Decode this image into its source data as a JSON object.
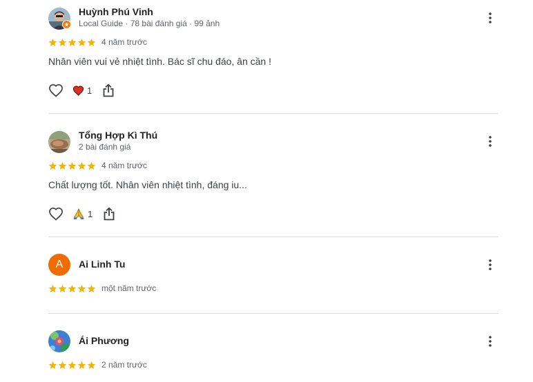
{
  "reviews": [
    {
      "name": "Huỳnh Phú Vinh",
      "meta": "Local Guide · 78 bài đánh giá · 99 ảnh",
      "stars": 5,
      "time": "4 năm trước",
      "text": "Nhân viên vui vẻ nhiệt tình. Bác sĩ chu đáo, ân cần !",
      "reaction_count": "1",
      "reaction_icon": "heart-reaction-icon"
    },
    {
      "name": "Tổng Hợp Kì Thú",
      "meta": "2 bài đánh giá",
      "stars": 5,
      "time": "4 năm trước",
      "text": "Chất lượng tốt. Nhân viên nhiệt tình, đáng iu...",
      "reaction_count": "1",
      "reaction_icon": "folded-hands-reaction-icon"
    },
    {
      "name": "Ai Linh Tu",
      "avatar_letter": "A",
      "stars": 5,
      "time": "một năm trước"
    },
    {
      "name": "Ái Phương",
      "stars": 5,
      "time": "2 năm trước"
    }
  ],
  "colors": {
    "star": "#f4b400",
    "heart": "#d93025",
    "avatar_letter_bg": "#ef6c00",
    "divider": "#dadce0"
  },
  "icons": [
    "like-icon",
    "share-icon",
    "more-options-icon",
    "star-icon",
    "local-guide-badge-icon"
  ]
}
